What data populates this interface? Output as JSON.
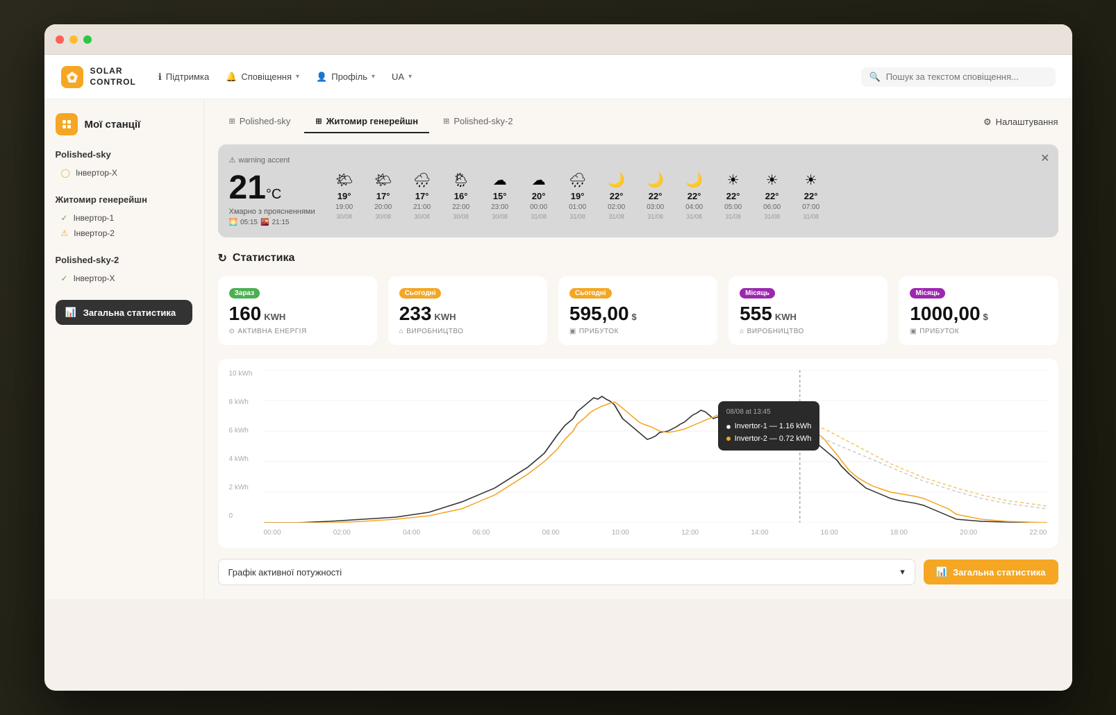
{
  "browser": {
    "dots": [
      "red",
      "yellow",
      "green"
    ]
  },
  "header": {
    "logo_text": "SOLAR\nCONTROL",
    "logo_emoji": "◈",
    "nav": [
      {
        "id": "support",
        "icon": "ℹ",
        "label": "Підтримка"
      },
      {
        "id": "notifications",
        "icon": "🔔",
        "label": "Сповіщення",
        "has_arrow": true
      },
      {
        "id": "profile",
        "icon": "👤",
        "label": "Профіль",
        "has_arrow": true
      },
      {
        "id": "language",
        "icon": "",
        "label": "UA",
        "has_arrow": true
      }
    ],
    "search_placeholder": "Пошук за текстом сповіщення..."
  },
  "sidebar": {
    "title": "Мої станції",
    "title_icon": "⊞",
    "stations": [
      {
        "name": "Polished-sky",
        "inverters": [
          {
            "label": "Інвертор-X",
            "status": "orange",
            "status_icon": "◯"
          }
        ]
      },
      {
        "name": "Житомир генерейшн",
        "inverters": [
          {
            "label": "Інвертор-1",
            "status": "green",
            "status_icon": "✓"
          },
          {
            "label": "Інвертор-2",
            "status": "orange",
            "status_icon": "⚠"
          }
        ]
      },
      {
        "name": "Polished-sky-2",
        "inverters": [
          {
            "label": "Інвертор-X",
            "status": "green",
            "status_icon": "✓"
          }
        ]
      }
    ],
    "stats_button": "Загальна статистика",
    "stats_icon": "📊"
  },
  "tabs": [
    {
      "id": "polished-sky",
      "label": "Polished-sky",
      "icon": "⊞",
      "active": false
    },
    {
      "id": "zhytomyr",
      "label": "Житомир генерейшн",
      "icon": "⊞",
      "active": true
    },
    {
      "id": "polished-sky-2",
      "label": "Polished-sky-2",
      "icon": "⊞",
      "active": false
    }
  ],
  "settings_btn": "Налаштування",
  "weather": {
    "warning_label": "warning accent",
    "current_temp": "21",
    "temp_unit": "°C",
    "description": "Хмарно з проясненнями",
    "sunrise": "05:15",
    "sunset": "21:15",
    "hours": [
      {
        "icon": "🌤",
        "temp": "19°",
        "time": "19:00",
        "date": "30/08"
      },
      {
        "icon": "🌤",
        "temp": "17°",
        "time": "20:00",
        "date": "30/08"
      },
      {
        "icon": "🌧",
        "temp": "17°",
        "time": "21:00",
        "date": "30/08"
      },
      {
        "icon": "🌦",
        "temp": "16°",
        "time": "22:00",
        "date": "30/08"
      },
      {
        "icon": "☁",
        "temp": "15°",
        "time": "23:00",
        "date": "30/08"
      },
      {
        "icon": "☁",
        "temp": "20°",
        "time": "00:00",
        "date": "31/08"
      },
      {
        "icon": "🌧",
        "temp": "19°",
        "time": "01:00",
        "date": "31/08"
      },
      {
        "icon": "🌙",
        "temp": "22°",
        "time": "02:00",
        "date": "31/08"
      },
      {
        "icon": "🌙",
        "temp": "22°",
        "time": "03:00",
        "date": "31/08"
      },
      {
        "icon": "🌙",
        "temp": "22°",
        "time": "04:00",
        "date": "31/08"
      },
      {
        "icon": "☀",
        "temp": "22°",
        "time": "05:00",
        "date": "31/08"
      },
      {
        "icon": "☀",
        "temp": "22°",
        "time": "06:00",
        "date": "31/08"
      },
      {
        "icon": "☀",
        "temp": "22°",
        "time": "07:00",
        "date": "31/08"
      }
    ]
  },
  "statistics": {
    "title": "Статистика",
    "title_icon": "↻",
    "cards": [
      {
        "badge": "Зараз",
        "badge_type": "green",
        "value": "160",
        "unit": "KWH",
        "label": "АКТИВНА ЕНЕРГІЯ",
        "label_icon": "⊙"
      },
      {
        "badge": "Сьогодні",
        "badge_type": "orange",
        "value": "233",
        "unit": "KWH",
        "label": "ВИРОБНИЦТВО",
        "label_icon": "⌂"
      },
      {
        "badge": "Сьогодні",
        "badge_type": "orange",
        "value": "595,00",
        "unit": "$",
        "label": "ПРИБУТОК",
        "label_icon": "▣"
      },
      {
        "badge": "Місяць",
        "badge_type": "purple",
        "value": "555",
        "unit": "KWH",
        "label": "ВИРОБНИЦТВО",
        "label_icon": "⌂"
      },
      {
        "badge": "Місяць",
        "badge_type": "purple",
        "value": "1000,00",
        "unit": "$",
        "label": "ПРИБУТОК",
        "label_icon": "▣"
      }
    ]
  },
  "chart": {
    "y_labels": [
      "0",
      "2 kWh",
      "4 kWh",
      "6 kWh",
      "8 kWh",
      "10 kWh"
    ],
    "x_labels": [
      "00:00",
      "02:00",
      "04:00",
      "06:00",
      "08:00",
      "10:00",
      "12:00",
      "14:00",
      "16:00",
      "18:00",
      "20:00",
      "22:00"
    ],
    "tooltip": {
      "title": "08/08 at 13:45",
      "rows": [
        {
          "color": "#333",
          "label": "Invertor-1 — 1.16 kWh"
        },
        {
          "color": "#f5a623",
          "label": "Invertor-2 — 0.72 kWh"
        }
      ]
    }
  },
  "bottom": {
    "select_label": "Графік активної потужності",
    "select_arrow": "▾",
    "stats_btn": "Загальна статистика",
    "stats_icon": "📊"
  }
}
